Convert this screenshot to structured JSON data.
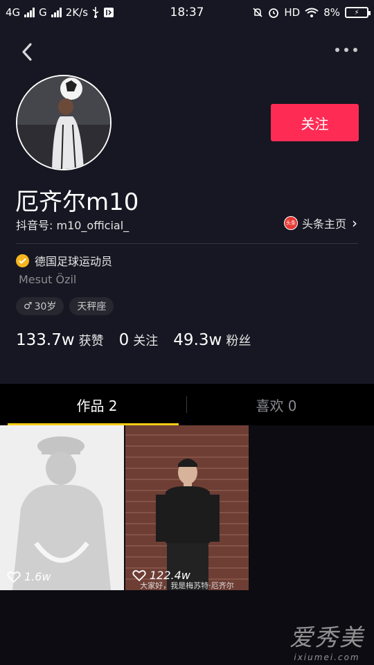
{
  "status_bar": {
    "net1": "4G",
    "net2": "G",
    "speed": "2K/s",
    "time": "18:37",
    "hd": "HD",
    "battery_pct": "8%"
  },
  "icons": {
    "back": "chevron-left-icon",
    "more": "more-horizontal-icon",
    "toutiao": "toutiao-badge-icon",
    "verified": "verified-check-icon",
    "male": "male-icon",
    "heart": "heart-outline-icon"
  },
  "colors": {
    "background": "#161722",
    "follow_button": "#fe2c55",
    "tab_indicator": "#face15",
    "verified_badge": "#f6b61e"
  },
  "profile": {
    "nickname": "厄齐尔m10",
    "douyin_id": "抖音号: m10_official_",
    "toutiao_badge": "头条",
    "toutiao_label": "头条主页",
    "follow_label": "关注",
    "verified_title": "德国足球运动员",
    "real_name": "Mesut Özil",
    "tags": {
      "age": "30岁",
      "zodiac": "天秤座"
    }
  },
  "stats": {
    "likes_num": "133.7w",
    "likes_label": "获赞",
    "following_num": "0",
    "following_label": "关注",
    "followers_num": "49.3w",
    "followers_label": "粉丝"
  },
  "tabs": {
    "works": "作品 2",
    "likes": "喜欢 0"
  },
  "videos": [
    {
      "likes": "1.6w"
    },
    {
      "likes": "122.4w",
      "caption": "大家好，我是梅苏特·厄齐尔"
    }
  ],
  "watermark": {
    "cn": "爱秀美",
    "en": "ixiumei.com"
  }
}
